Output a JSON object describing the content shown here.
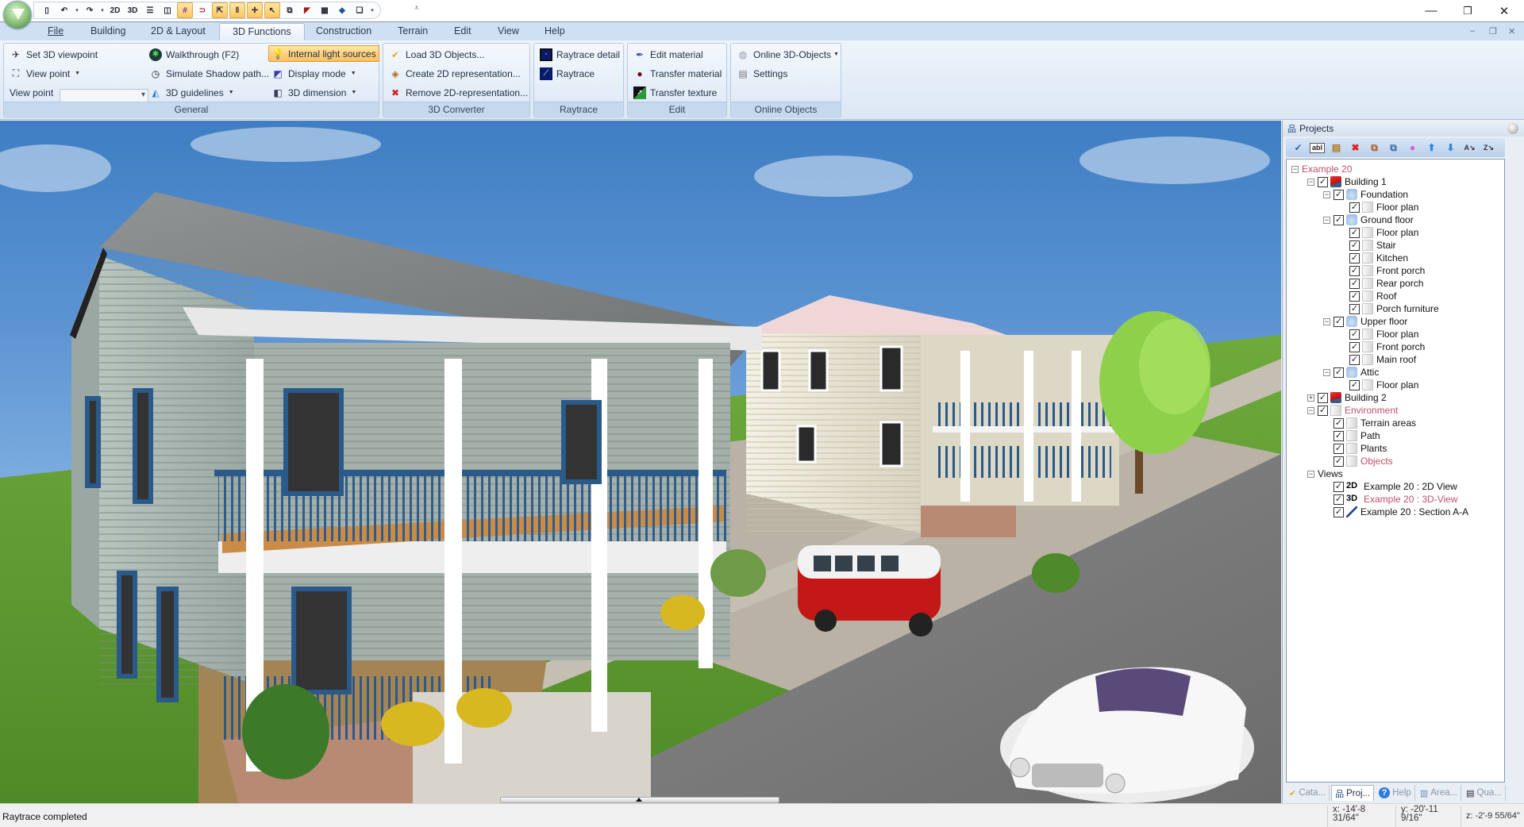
{
  "window": {
    "minimize_label": "—",
    "restore_label": "❐",
    "close_label": "✕"
  },
  "quick_access": {
    "buttons": [
      {
        "name": "new-document",
        "glyph": "▯"
      },
      {
        "name": "undo",
        "glyph": "↶"
      },
      {
        "name": "redo",
        "glyph": "↷"
      },
      {
        "name": "view-2d",
        "glyph": "2D"
      },
      {
        "name": "view-3d",
        "glyph": "3D"
      },
      {
        "name": "horizontal-split",
        "glyph": "☰"
      },
      {
        "name": "vertical-split",
        "glyph": "◫"
      },
      {
        "name": "grid",
        "glyph": "#"
      },
      {
        "name": "magnet-snap",
        "glyph": "⊃"
      },
      {
        "name": "select-cursor",
        "glyph": "⇱"
      },
      {
        "name": "guidelines",
        "glyph": "‖"
      },
      {
        "name": "crosshair",
        "glyph": "✛"
      },
      {
        "name": "pointer",
        "glyph": "↖"
      },
      {
        "name": "window-tool",
        "glyph": "⧉"
      },
      {
        "name": "wall-tool",
        "glyph": "◤"
      },
      {
        "name": "texture-tool",
        "glyph": "▦"
      },
      {
        "name": "ruler-tool",
        "glyph": "◆"
      },
      {
        "name": "copy-tool",
        "glyph": "❏"
      }
    ],
    "more_glyph": "⩡"
  },
  "menu_tabs": [
    "File",
    "Building",
    "2D & Layout",
    "3D Functions",
    "Construction",
    "Terrain",
    "Edit",
    "View",
    "Help"
  ],
  "active_tab": "3D Functions",
  "mdi_controls": {
    "minimize": "–",
    "restore": "❐",
    "close": "✕"
  },
  "ribbon": {
    "general": {
      "label": "General",
      "set_3d_viewpoint": "Set 3D viewpoint",
      "view_point": "View point",
      "view_point_combo_label": "View point",
      "view_point_combo_value": "",
      "walkthrough": "Walkthrough (F2)",
      "simulate_shadow": "Simulate Shadow path...",
      "guidelines_3d": "3D guidelines",
      "internal_light": "Internal light sources",
      "display_mode": "Display mode",
      "dimension_3d": "3D dimension"
    },
    "converter": {
      "label": "3D Converter",
      "load": "Load 3D Objects...",
      "create_2d": "Create 2D representation...",
      "remove_2d": "Remove 2D-representation..."
    },
    "raytrace": {
      "label": "Raytrace",
      "detail": "Raytrace detail",
      "raytrace": "Raytrace"
    },
    "edit": {
      "label": "Edit",
      "edit_material": "Edit material",
      "transfer_material": "Transfer material",
      "transfer_texture": "Transfer texture"
    },
    "online": {
      "label": "Online Objects",
      "online_3d": "Online 3D-Objects",
      "settings": "Settings"
    }
  },
  "panel": {
    "title": "Projects",
    "toolbar": [
      {
        "name": "check",
        "glyph": "✓",
        "color": "#2a5aa8"
      },
      {
        "name": "rename",
        "glyph": "abl",
        "color": "#222"
      },
      {
        "name": "properties",
        "glyph": "▤",
        "color": "#b07a20"
      },
      {
        "name": "delete",
        "glyph": "✖",
        "color": "#e02020"
      },
      {
        "name": "copy",
        "glyph": "⧉",
        "color": "#b05a20"
      },
      {
        "name": "paste",
        "glyph": "⧉",
        "color": "#3a6aa8"
      },
      {
        "name": "color",
        "glyph": "●",
        "color": "#e05ad0"
      },
      {
        "name": "move-up",
        "glyph": "⬆",
        "color": "#2a8ae0"
      },
      {
        "name": "move-down",
        "glyph": "⬇",
        "color": "#2a8ae0"
      },
      {
        "name": "sort-az",
        "glyph": "A↘",
        "color": "#333"
      },
      {
        "name": "sort-za",
        "glyph": "Z↘",
        "color": "#333"
      }
    ],
    "tree": [
      {
        "label": "Example 20",
        "level": 0,
        "expander": "−",
        "checkbox": false,
        "icon": "none",
        "red": true
      },
      {
        "label": "Building 1",
        "level": 1,
        "expander": "−",
        "checkbox": true,
        "icon": "bldg",
        "red": false
      },
      {
        "label": "Foundation",
        "level": 2,
        "expander": "−",
        "checkbox": true,
        "icon": "floor",
        "red": false
      },
      {
        "label": "Floor plan",
        "level": 3,
        "expander": "",
        "checkbox": true,
        "icon": "page",
        "red": false
      },
      {
        "label": "Ground floor",
        "level": 2,
        "expander": "−",
        "checkbox": true,
        "icon": "floor",
        "red": false
      },
      {
        "label": "Floor plan",
        "level": 3,
        "expander": "",
        "checkbox": true,
        "icon": "page",
        "red": false
      },
      {
        "label": "Stair",
        "level": 3,
        "expander": "",
        "checkbox": true,
        "icon": "page",
        "red": false
      },
      {
        "label": "Kitchen",
        "level": 3,
        "expander": "",
        "checkbox": true,
        "icon": "page",
        "red": false
      },
      {
        "label": "Front porch",
        "level": 3,
        "expander": "",
        "checkbox": true,
        "icon": "page",
        "red": false
      },
      {
        "label": "Rear porch",
        "level": 3,
        "expander": "",
        "checkbox": true,
        "icon": "page",
        "red": false
      },
      {
        "label": "Roof",
        "level": 3,
        "expander": "",
        "checkbox": true,
        "icon": "page",
        "red": false
      },
      {
        "label": "Porch furniture",
        "level": 3,
        "expander": "",
        "checkbox": true,
        "icon": "page",
        "red": false
      },
      {
        "label": "Upper floor",
        "level": 2,
        "expander": "−",
        "checkbox": true,
        "icon": "floor",
        "red": false
      },
      {
        "label": "Floor plan",
        "level": 3,
        "expander": "",
        "checkbox": true,
        "icon": "page",
        "red": false
      },
      {
        "label": "Front porch",
        "level": 3,
        "expander": "",
        "checkbox": true,
        "icon": "page",
        "red": false
      },
      {
        "label": "Main roof",
        "level": 3,
        "expander": "",
        "checkbox": true,
        "icon": "page",
        "red": false
      },
      {
        "label": "Attic",
        "level": 2,
        "expander": "−",
        "checkbox": true,
        "icon": "floor",
        "red": false
      },
      {
        "label": "Floor plan",
        "level": 3,
        "expander": "",
        "checkbox": true,
        "icon": "page",
        "red": false
      },
      {
        "label": "Building 2",
        "level": 1,
        "expander": "+",
        "checkbox": true,
        "icon": "bldg",
        "red": false
      },
      {
        "label": "Environment",
        "level": 1,
        "expander": "−",
        "checkbox": true,
        "icon": "page",
        "red": true
      },
      {
        "label": "Terrain areas",
        "level": 2,
        "expander": "",
        "checkbox": true,
        "icon": "page",
        "red": false
      },
      {
        "label": "Path",
        "level": 2,
        "expander": "",
        "checkbox": true,
        "icon": "page",
        "red": false
      },
      {
        "label": "Plants",
        "level": 2,
        "expander": "",
        "checkbox": true,
        "icon": "page",
        "red": false
      },
      {
        "label": "Objects",
        "level": 2,
        "expander": "",
        "checkbox": true,
        "icon": "page",
        "red": true
      },
      {
        "label": "Views",
        "level": 1,
        "expander": "−",
        "checkbox": false,
        "icon": "none",
        "red": false
      },
      {
        "label": "Example 20 : 2D View",
        "level": 2,
        "expander": "",
        "checkbox": true,
        "icon": "2d",
        "red": false
      },
      {
        "label": "Example 20 : 3D-View",
        "level": 2,
        "expander": "",
        "checkbox": true,
        "icon": "3d",
        "red": true
      },
      {
        "label": "Example 20 : Section A-A",
        "level": 2,
        "expander": "",
        "checkbox": true,
        "icon": "sect",
        "red": false
      }
    ],
    "bottom_tabs": [
      {
        "label": "Cata...",
        "icon": "catalog"
      },
      {
        "label": "Proj...",
        "icon": "projects",
        "active": true
      },
      {
        "label": "Help",
        "icon": "help"
      },
      {
        "label": "Area...",
        "icon": "area"
      },
      {
        "label": "Qua...",
        "icon": "quantities"
      }
    ]
  },
  "status": {
    "text": "Raytrace completed",
    "x": "x: -14'-8 31/64\"",
    "y": "y: -20'-11 9/16\"",
    "z": "z: -2'-9 55/64\""
  },
  "colors": {
    "ribbon_bg": "#dbe7f4",
    "highlight": "#ffbe5e",
    "tree_red_label": "#c0506a"
  }
}
